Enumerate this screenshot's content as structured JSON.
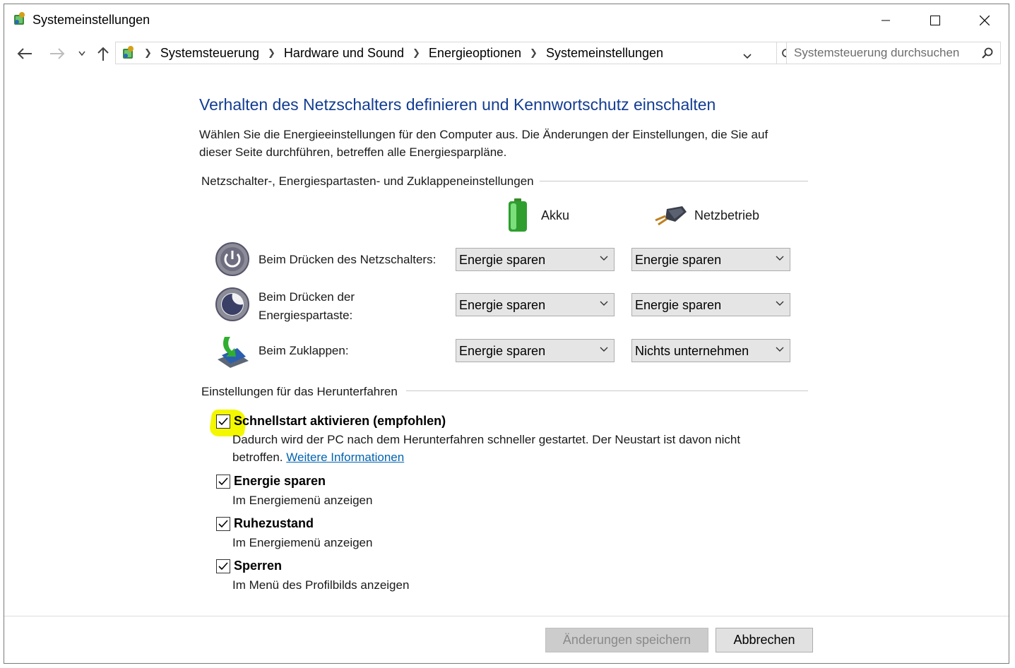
{
  "window": {
    "title": "Systemeinstellungen",
    "controls": {
      "minimize": "minimize",
      "maximize": "maximize",
      "close": "close"
    }
  },
  "address_bar": {
    "breadcrumbs": [
      "Systemsteuerung",
      "Hardware und Sound",
      "Energieoptionen",
      "Systemeinstellungen"
    ]
  },
  "search": {
    "placeholder": "Systemsteuerung durchsuchen"
  },
  "page": {
    "heading": "Verhalten des Netzschalters definieren und Kennwortschutz einschalten",
    "intro": "Wählen Sie die Energieeinstellungen für den Computer aus. Die Änderungen der Einstellungen, die Sie auf dieser Seite durchführen, betreffen alle Energiesparpläne."
  },
  "buttons_section": {
    "label": "Netzschalter-, Energiespartasten- und Zuklappeneinstellungen",
    "columns": {
      "battery": "Akku",
      "plugged": "Netzbetrieb"
    },
    "rows": [
      {
        "label": "Beim Drücken des Netzschalters:",
        "battery": "Energie sparen",
        "plugged": "Energie sparen",
        "icon": "power-button-icon"
      },
      {
        "label": "Beim Drücken der Energiespartaste:",
        "battery": "Energie sparen",
        "plugged": "Energie sparen",
        "icon": "sleep-button-icon"
      },
      {
        "label": "Beim Zuklappen:",
        "battery": "Energie sparen",
        "plugged": "Nichts unternehmen",
        "icon": "lid-close-icon"
      }
    ]
  },
  "shutdown_section": {
    "label": "Einstellungen für das Herunterfahren",
    "options": [
      {
        "title": "Schnellstart aktivieren (empfohlen)",
        "desc": "Dadurch wird der PC nach dem Herunterfahren schneller gestartet. Der Neustart ist davon nicht betroffen.",
        "link": "Weitere Informationen",
        "checked": true,
        "highlighted": true
      },
      {
        "title": "Energie sparen",
        "desc": "Im Energiemenü anzeigen",
        "checked": true
      },
      {
        "title": "Ruhezustand",
        "desc": "Im Energiemenü anzeigen",
        "checked": true
      },
      {
        "title": "Sperren",
        "desc": "Im Menü des Profilbilds anzeigen",
        "checked": true
      }
    ]
  },
  "footer": {
    "save": "Änderungen speichern",
    "cancel": "Abbrechen",
    "save_enabled": false
  },
  "colors": {
    "heading": "#123d91",
    "link": "#0063b1",
    "highlight": "#f3f700",
    "dropdown_bg": "#e5e5e5"
  }
}
